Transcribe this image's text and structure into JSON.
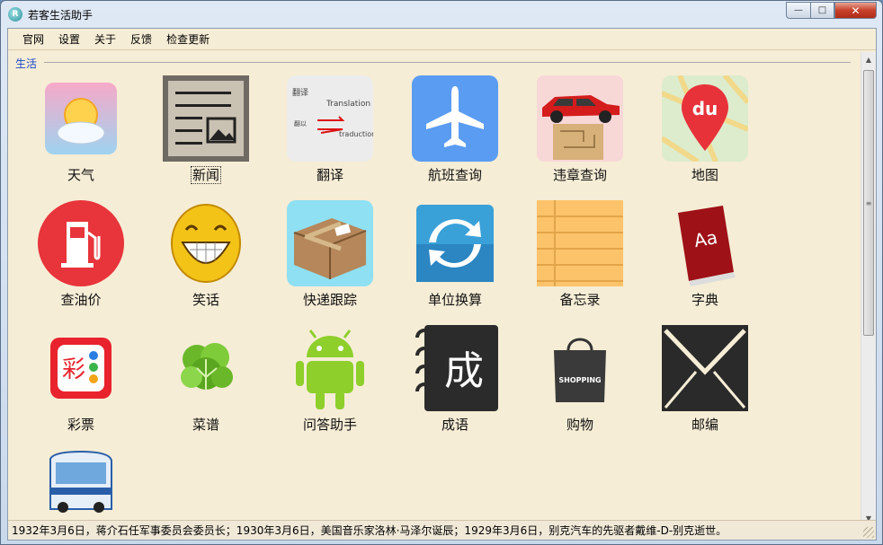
{
  "window": {
    "title": "若客生活助手",
    "app_icon_glyph": "R",
    "controls": {
      "minimize": "—",
      "maximize": "□",
      "close": "✕"
    }
  },
  "menu": [
    "官网",
    "设置",
    "关于",
    "反馈",
    "检查更新"
  ],
  "group": {
    "label": "生活"
  },
  "tiles": [
    {
      "label": "天气",
      "icon": "weather-sun-cloud-icon"
    },
    {
      "label": "新闻",
      "icon": "newspaper-icon",
      "focused": true
    },
    {
      "label": "翻译",
      "icon": "translation-icon",
      "texts": [
        "翻译",
        "Translation",
        "翻以",
        "traduction"
      ]
    },
    {
      "label": "航班查询",
      "icon": "airplane-icon"
    },
    {
      "label": "违章查询",
      "icon": "red-car-ticket-icon"
    },
    {
      "label": "地图",
      "icon": "baidu-map-pin-icon",
      "texts": [
        "du"
      ]
    },
    {
      "label": "查油价",
      "icon": "fuel-pump-icon"
    },
    {
      "label": "笑话",
      "icon": "laughing-face-icon"
    },
    {
      "label": "快递跟踪",
      "icon": "parcel-box-icon"
    },
    {
      "label": "单位换算",
      "icon": "sync-arrows-icon"
    },
    {
      "label": "备忘录",
      "icon": "notepad-icon"
    },
    {
      "label": "字典",
      "icon": "dictionary-book-icon",
      "texts": [
        "Aa"
      ]
    },
    {
      "label": "彩票",
      "icon": "lottery-icon",
      "texts": [
        "彩"
      ]
    },
    {
      "label": "菜谱",
      "icon": "lettuce-icon"
    },
    {
      "label": "问答助手",
      "icon": "android-robot-icon"
    },
    {
      "label": "成语",
      "icon": "idiom-notebook-icon",
      "texts": [
        "成"
      ]
    },
    {
      "label": "购物",
      "icon": "shopping-bag-icon",
      "texts": [
        "SHOPPING"
      ]
    },
    {
      "label": "邮编",
      "icon": "envelope-icon"
    },
    {
      "label": "",
      "icon": "bus-icon"
    }
  ],
  "status": {
    "text": "1932年3月6日，蒋介石任军事委员会委员长；1930年3月6日，美国音乐家洛林·马泽尔诞辰；1929年3月6日，别克汽车的先驱者戴维-D-别克逝世。"
  },
  "scrollbar": {
    "up": "▲",
    "down": "▼",
    "grip": "≡"
  },
  "colors": {
    "group_label": "#1a46c8",
    "background": "#f6edd6"
  }
}
